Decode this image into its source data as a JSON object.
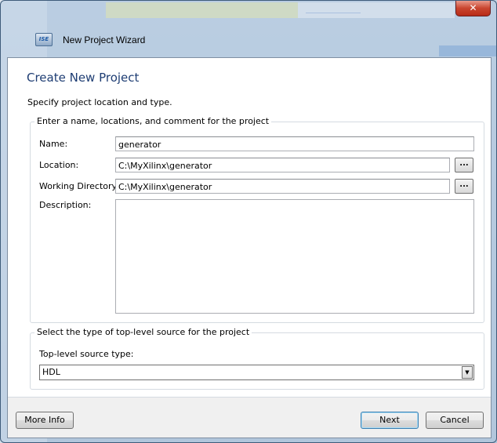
{
  "window": {
    "title": "New Project Wizard",
    "app_icon_text": "ISE",
    "close_glyph": "✕"
  },
  "page": {
    "heading": "Create New Project",
    "subheading": "Specify project location and type."
  },
  "project_group": {
    "legend": "Enter a name, locations, and comment for the project",
    "name_label": "Name:",
    "name_value": "generator",
    "location_label": "Location:",
    "location_value": "C:\\MyXilinx\\generator",
    "working_dir_label": "Working Directory:",
    "working_dir_value": "C:\\MyXilinx\\generator",
    "description_label": "Description:",
    "description_value": "",
    "browse_label": "..."
  },
  "source_group": {
    "legend": "Select the type of top-level source for the project",
    "source_type_label": "Top-level source type:",
    "source_type_value": "HDL",
    "dropdown_glyph": "▼"
  },
  "footer": {
    "more_info_label": "More Info",
    "next_label": "Next",
    "cancel_label": "Cancel"
  },
  "colors": {
    "heading": "#1e3d73",
    "close_button": "#c9452f",
    "default_button_border": "#3c7fb1"
  }
}
